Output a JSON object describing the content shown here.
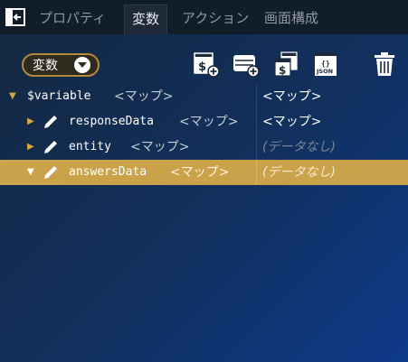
{
  "tabs": [
    {
      "label": "プロパティ",
      "active": false
    },
    {
      "label": "変数",
      "active": true
    },
    {
      "label": "アクション",
      "active": false
    },
    {
      "label": "画面構成",
      "active": false
    }
  ],
  "toolbar": {
    "variable_select": {
      "value": "変数",
      "icon": "chevron-down-icon"
    },
    "icons": [
      "add-variable-icon",
      "add-database-variable-icon",
      "duplicate-variable-icon",
      "json-icon",
      "trash-icon"
    ],
    "json_label": "JSON"
  },
  "tree": {
    "rows": [
      {
        "name": "$variable",
        "type": "<マップ>",
        "value": "<マップ>",
        "expanded": true,
        "selected": false
      },
      {
        "name": "responseData",
        "type": "<マップ>",
        "value": "<マップ>",
        "expanded": false,
        "selected": false
      },
      {
        "name": "entity",
        "type": "<マップ>",
        "value": "(データなし)",
        "expanded": false,
        "selected": false
      },
      {
        "name": "answersData",
        "type": "<マップ>",
        "value": "(データなし)",
        "expanded": true,
        "selected": true
      }
    ]
  },
  "colors": {
    "accent": "#c9a24a",
    "expander": "#d7a63c",
    "tabbar": "#121d2a"
  }
}
